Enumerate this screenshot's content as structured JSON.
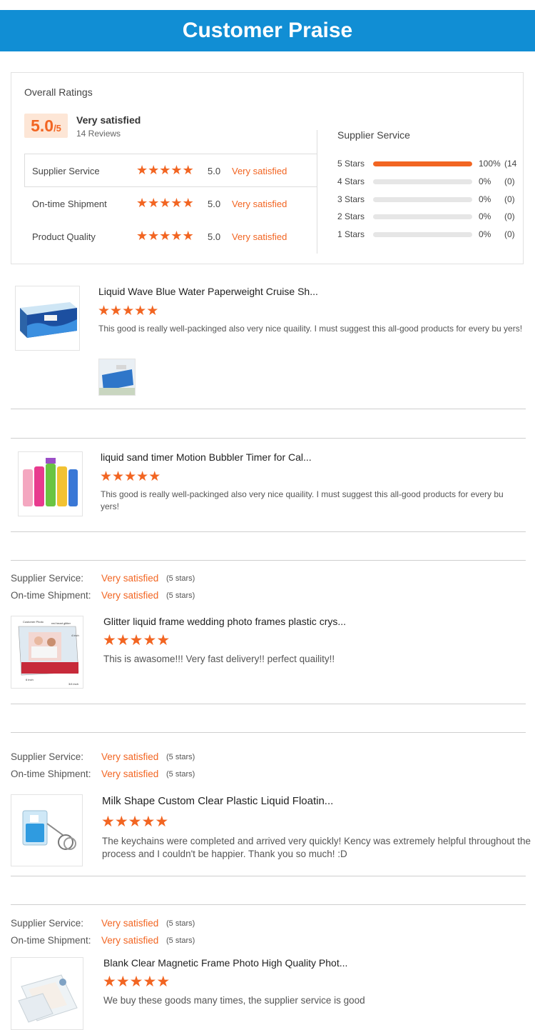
{
  "header": {
    "title": "Customer Praise"
  },
  "overall": {
    "title": "Overall Ratings",
    "score": "5.0",
    "score_suffix": "/5",
    "label": "Very satisfied",
    "reviews": "14 Reviews",
    "categories": [
      {
        "label": "Supplier Service",
        "score": "5.0",
        "rating": "Very satisfied",
        "stars": 5
      },
      {
        "label": "On-time Shipment",
        "score": "5.0",
        "rating": "Very satisfied",
        "stars": 5
      },
      {
        "label": "Product Quality",
        "score": "5.0",
        "rating": "Very satisfied",
        "stars": 5
      }
    ]
  },
  "supplier_distribution": {
    "title": "Supplier Service",
    "rows": [
      {
        "label": "5 Stars",
        "fraction": 1.0,
        "pct": "100%",
        "count": "(14"
      },
      {
        "label": "4 Stars",
        "fraction": 0.0,
        "pct": "0%",
        "count": "(0)"
      },
      {
        "label": "3 Stars",
        "fraction": 0.0,
        "pct": "0%",
        "count": "(0)"
      },
      {
        "label": "2 Stars",
        "fraction": 0.0,
        "pct": "0%",
        "count": "(0)"
      },
      {
        "label": "1 Stars",
        "fraction": 0.0,
        "pct": "0%",
        "count": "(0)"
      }
    ]
  },
  "reviews": [
    {
      "title": "Liquid Wave Blue Water Paperweight Cruise Sh...",
      "stars": 5,
      "text": "This good is really well-packinged also very nice quaility. I must suggest this all-good products for every bu yers!"
    },
    {
      "title": "liquid sand timer Motion Bubbler Timer for Cal...",
      "stars": 5,
      "text": "This good is really well-packinged also very nice quaility. I must suggest this all-good products for every bu yers!"
    },
    {
      "supplier_label": "Supplier Service:",
      "supplier_rating": "Very satisfied",
      "supplier_stars": "(5 stars)",
      "shipment_label": "On-time Shipment:",
      "shipment_rating": "Very satisfied",
      "shipment_stars": "(5 stars)",
      "title": "Glitter liquid frame wedding photo frames plastic crys...",
      "stars": 5,
      "text": "This is awasome!!! Very fast delivery!! perfect quaility!!",
      "image_text": {
        "top": "Customer Photo",
        "top_right": "red heart glitter",
        "bottom": "6 inch",
        "right": "4 inch",
        "corner": "3/4 inch"
      }
    },
    {
      "supplier_label": "Supplier Service:",
      "supplier_rating": "Very satisfied",
      "supplier_stars": "(5 stars)",
      "shipment_label": "On-time Shipment:",
      "shipment_rating": "Very satisfied",
      "shipment_stars": "(5 stars)",
      "title": "Milk Shape Custom Clear Plastic Liquid Floatin...",
      "stars": 5,
      "text": "The keychains were completed and arrived very quickly! Kency was extremely helpful throughout the process and I couldn't be happier. Thank you so much! :D"
    },
    {
      "supplier_label": "Supplier Service:",
      "supplier_rating": "Very satisfied",
      "supplier_stars": "(5 stars)",
      "shipment_label": "On-time Shipment:",
      "shipment_rating": "Very satisfied",
      "shipment_stars": "(5 stars)",
      "title": "Blank Clear Magnetic Frame Photo High Quality Phot...",
      "stars": 5,
      "text": "We buy these goods many times, the supplier service is good"
    }
  ],
  "icons": {
    "star": "star-icon"
  },
  "colors": {
    "header": "#118ed4",
    "accent": "#f26522",
    "score_bg": "#fde6d6",
    "bar_track": "#e6e6e6"
  }
}
